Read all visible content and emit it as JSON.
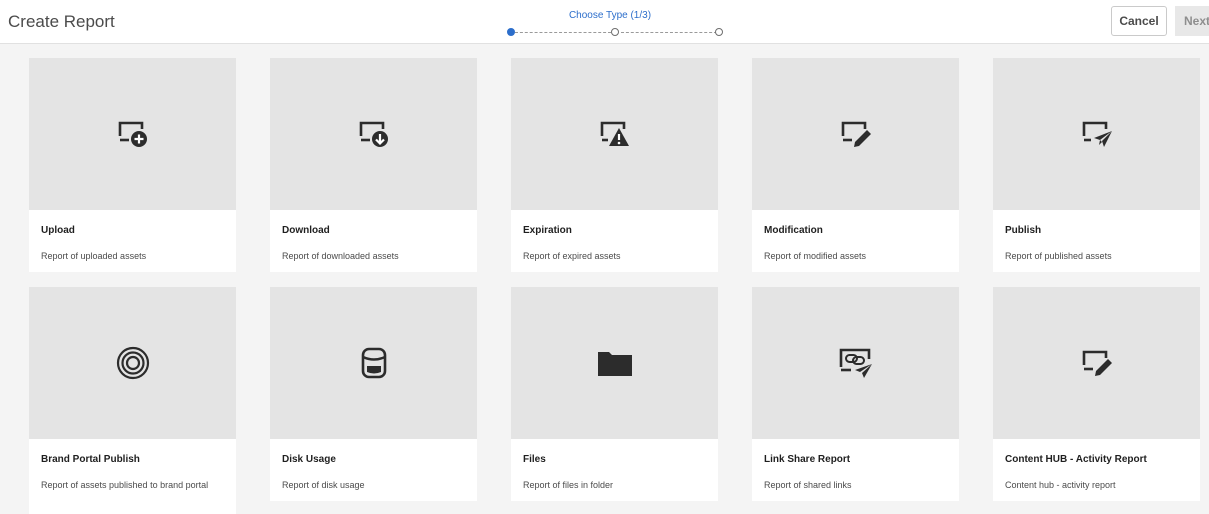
{
  "header": {
    "title": "Create Report",
    "step_label": "Choose Type (1/3)",
    "cancel_label": "Cancel",
    "next_label": "Next"
  },
  "cards": [
    {
      "name": "Upload",
      "desc": "Report of uploaded assets",
      "icon": "upload-icon"
    },
    {
      "name": "Download",
      "desc": "Report of downloaded assets",
      "icon": "download-icon"
    },
    {
      "name": "Expiration",
      "desc": "Report of expired assets",
      "icon": "expiration-icon"
    },
    {
      "name": "Modification",
      "desc": "Report of modified assets",
      "icon": "modification-icon"
    },
    {
      "name": "Publish",
      "desc": "Report of published assets",
      "icon": "publish-icon"
    },
    {
      "name": "Brand Portal Publish",
      "desc": "Report of assets published to brand portal",
      "icon": "brand-portal-icon"
    },
    {
      "name": "Disk Usage",
      "desc": "Report of disk usage",
      "icon": "disk-usage-icon"
    },
    {
      "name": "Files",
      "desc": "Report of files in folder",
      "icon": "folder-icon"
    },
    {
      "name": "Link Share Report",
      "desc": "Report of shared links",
      "icon": "link-share-icon"
    },
    {
      "name": "Content HUB - Activity Report",
      "desc": "Content hub - activity report",
      "icon": "content-hub-icon"
    }
  ],
  "colors": {
    "accent": "#2c6ecb",
    "tile": "#e4e4e4",
    "icon": "#2c2c2c"
  }
}
